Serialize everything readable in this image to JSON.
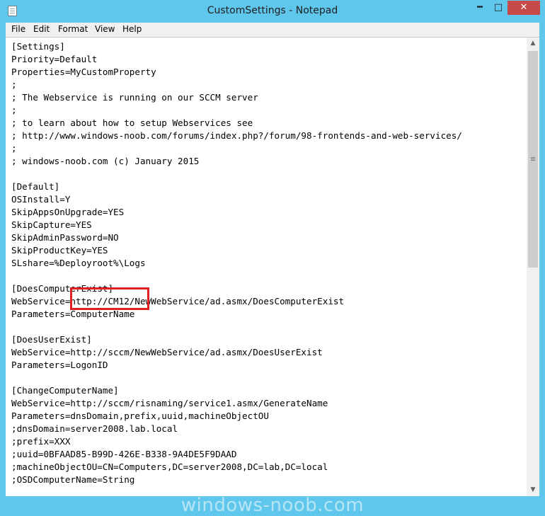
{
  "window": {
    "title": "CustomSettings - Notepad",
    "min_glyph": "━",
    "max_glyph": "□",
    "close_glyph": "✕"
  },
  "menu": {
    "file": "File",
    "edit": "Edit",
    "format": "Format",
    "view": "View",
    "help": "Help"
  },
  "document": {
    "lines": [
      "[Settings]",
      "Priority=Default",
      "Properties=MyCustomProperty",
      ";",
      "; The Webservice is running on our SCCM server",
      ";",
      "; to learn about how to setup Webservices see",
      "; http://www.windows-noob.com/forums/index.php?/forum/98-frontends-and-web-services/",
      ";",
      "; windows-noob.com (c) January 2015",
      "",
      "[Default]",
      "OSInstall=Y",
      "SkipAppsOnUpgrade=YES",
      "SkipCapture=YES",
      "SkipAdminPassword=NO",
      "SkipProductKey=YES",
      "SLshare=%Deployroot%\\Logs",
      "",
      "[DoesComputerExist]",
      "WebService=http://CM12/NewWebService/ad.asmx/DoesComputerExist",
      "Parameters=ComputerName",
      "",
      "[DoesUserExist]",
      "WebService=http://sccm/NewWebService/ad.asmx/DoesUserExist",
      "Parameters=LogonID",
      "",
      "[ChangeComputerName]",
      "WebService=http://sccm/risnaming/service1.asmx/GenerateName",
      "Parameters=dnsDomain,prefix,uuid,machineObjectOU",
      ";dnsDomain=server2008.lab.local",
      ";prefix=XXX",
      ";uuid=0BFAAD85-B99D-426E-B338-9A4DE5F9DAAD",
      ";machineObjectOU=CN=Computers,DC=server2008,DC=lab,DC=local",
      ";OSDComputerName=String"
    ]
  },
  "scrollbar": {
    "up_glyph": "▲",
    "down_glyph": "▼"
  },
  "watermark": "windows-noob.com",
  "colors": {
    "titlebar": "#5fc6ec",
    "close_button": "#c74a4a",
    "highlight": "#e02020"
  }
}
